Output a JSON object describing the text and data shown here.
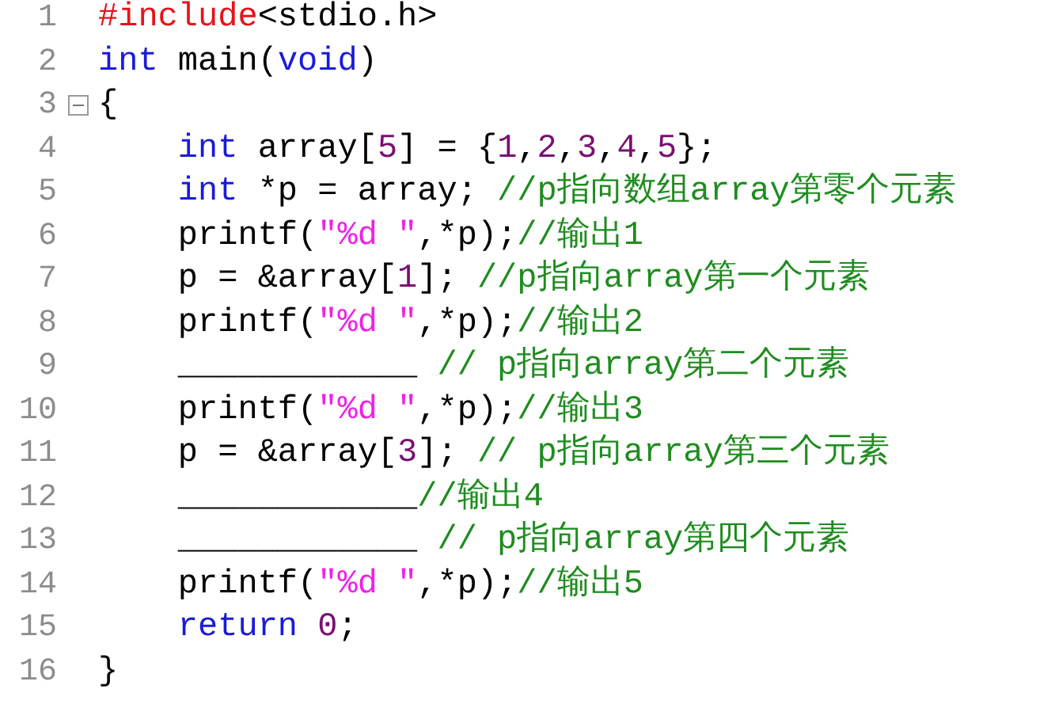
{
  "code_lines": [
    {
      "number": "1",
      "foldable": false,
      "tokens": [
        {
          "kind": "preprocessor",
          "text": "#include"
        },
        {
          "kind": "plain",
          "text": "<stdio.h>"
        }
      ]
    },
    {
      "number": "2",
      "foldable": false,
      "tokens": [
        {
          "kind": "keyword",
          "text": "int"
        },
        {
          "kind": "plain",
          "text": " main("
        },
        {
          "kind": "keyword",
          "text": "void"
        },
        {
          "kind": "plain",
          "text": ")"
        }
      ]
    },
    {
      "number": "3",
      "foldable": true,
      "tokens": [
        {
          "kind": "plain",
          "text": "{"
        }
      ],
      "children": [
        {
          "number": "4",
          "foldable": false,
          "tokens": [
            {
              "kind": "keyword",
              "text": "int"
            },
            {
              "kind": "plain",
              "text": " array["
            },
            {
              "kind": "number",
              "text": "5"
            },
            {
              "kind": "plain",
              "text": "] = {"
            },
            {
              "kind": "number",
              "text": "1"
            },
            {
              "kind": "plain",
              "text": ","
            },
            {
              "kind": "number",
              "text": "2"
            },
            {
              "kind": "plain",
              "text": ","
            },
            {
              "kind": "number",
              "text": "3"
            },
            {
              "kind": "plain",
              "text": ","
            },
            {
              "kind": "number",
              "text": "4"
            },
            {
              "kind": "plain",
              "text": ","
            },
            {
              "kind": "number",
              "text": "5"
            },
            {
              "kind": "plain",
              "text": "};"
            }
          ]
        },
        {
          "number": "5",
          "foldable": false,
          "tokens": [
            {
              "kind": "keyword",
              "text": "int"
            },
            {
              "kind": "plain",
              "text": " *p = array; "
            },
            {
              "kind": "comment",
              "text": "//p指向数组array第零个元素"
            }
          ]
        },
        {
          "number": "6",
          "foldable": false,
          "tokens": [
            {
              "kind": "plain",
              "text": "printf("
            },
            {
              "kind": "string",
              "text": "\"%d \""
            },
            {
              "kind": "plain",
              "text": ",*p);"
            },
            {
              "kind": "comment",
              "text": "//输出1"
            }
          ]
        },
        {
          "number": "7",
          "foldable": false,
          "tokens": [
            {
              "kind": "plain",
              "text": "p = &array["
            },
            {
              "kind": "number",
              "text": "1"
            },
            {
              "kind": "plain",
              "text": "]; "
            },
            {
              "kind": "comment",
              "text": "//p指向array第一个元素"
            }
          ]
        },
        {
          "number": "8",
          "foldable": false,
          "tokens": [
            {
              "kind": "plain",
              "text": "printf("
            },
            {
              "kind": "string",
              "text": "\"%d \""
            },
            {
              "kind": "plain",
              "text": ",*p);"
            },
            {
              "kind": "comment",
              "text": "//输出2"
            }
          ]
        },
        {
          "number": "9",
          "foldable": false,
          "tokens": [
            {
              "kind": "plain",
              "text": "____________ "
            },
            {
              "kind": "comment",
              "text": "// p指向array第二个元素"
            }
          ]
        },
        {
          "number": "10",
          "foldable": false,
          "tokens": [
            {
              "kind": "plain",
              "text": "printf("
            },
            {
              "kind": "string",
              "text": "\"%d \""
            },
            {
              "kind": "plain",
              "text": ",*p);"
            },
            {
              "kind": "comment",
              "text": "//输出3"
            }
          ]
        },
        {
          "number": "11",
          "foldable": false,
          "tokens": [
            {
              "kind": "plain",
              "text": "p = &array["
            },
            {
              "kind": "number",
              "text": "3"
            },
            {
              "kind": "plain",
              "text": "]; "
            },
            {
              "kind": "comment",
              "text": "// p指向array第三个元素"
            }
          ]
        },
        {
          "number": "12",
          "foldable": false,
          "tokens": [
            {
              "kind": "plain",
              "text": "____________"
            },
            {
              "kind": "comment",
              "text": "//输出4"
            }
          ]
        },
        {
          "number": "13",
          "foldable": false,
          "tokens": [
            {
              "kind": "plain",
              "text": "____________ "
            },
            {
              "kind": "comment",
              "text": "// p指向array第四个元素"
            }
          ]
        },
        {
          "number": "14",
          "foldable": false,
          "tokens": [
            {
              "kind": "plain",
              "text": "printf("
            },
            {
              "kind": "string",
              "text": "\"%d \""
            },
            {
              "kind": "plain",
              "text": ",*p);"
            },
            {
              "kind": "comment",
              "text": "//输出5"
            }
          ]
        },
        {
          "number": "15",
          "foldable": false,
          "tokens": [
            {
              "kind": "keyword",
              "text": "return "
            },
            {
              "kind": "number",
              "text": "0"
            },
            {
              "kind": "plain",
              "text": ";"
            }
          ]
        }
      ]
    },
    {
      "number": "16",
      "foldable": false,
      "tokens": [
        {
          "kind": "plain",
          "text": "}"
        }
      ]
    }
  ]
}
